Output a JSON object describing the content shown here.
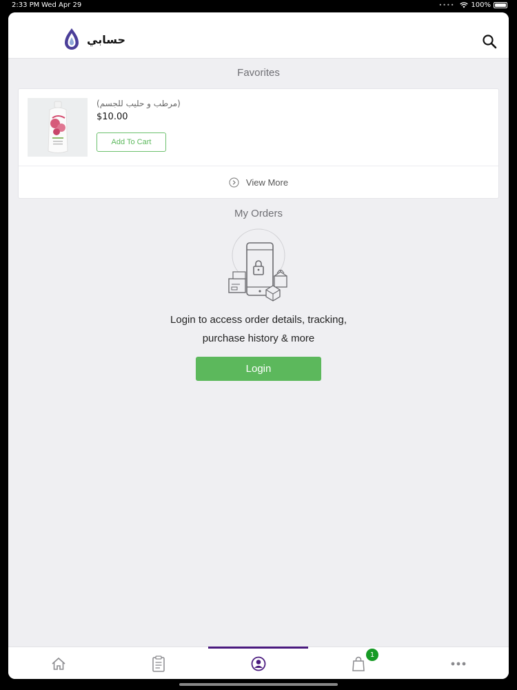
{
  "status_bar": {
    "time": "2:33 PM",
    "date": "Wed Apr 29",
    "battery": "100%",
    "battery_level": 1.0
  },
  "header": {
    "title": "حسابي",
    "logo_icon": "drop-logo-icon",
    "search_icon": "search-icon"
  },
  "favorites": {
    "title": "Favorites",
    "items": [
      {
        "name": "(مرطب و حليب للجسم)",
        "price": "$10.00",
        "add_to_cart_label": "Add To Cart"
      }
    ],
    "view_more_label": "View More"
  },
  "orders": {
    "title": "My Orders",
    "message_line1": "Login to access order details, tracking,",
    "message_line2": "purchase history & more",
    "login_label": "Login"
  },
  "tabs": [
    {
      "name": "home",
      "icon": "home-icon"
    },
    {
      "name": "orders",
      "icon": "clipboard-icon"
    },
    {
      "name": "account",
      "icon": "user-icon",
      "active": true
    },
    {
      "name": "cart",
      "icon": "bag-icon",
      "badge": "1"
    },
    {
      "name": "more",
      "icon": "more-icon"
    }
  ],
  "colors": {
    "accent": "#5cb85c",
    "active_tab": "#4a1a7e",
    "badge": "#169a24"
  }
}
